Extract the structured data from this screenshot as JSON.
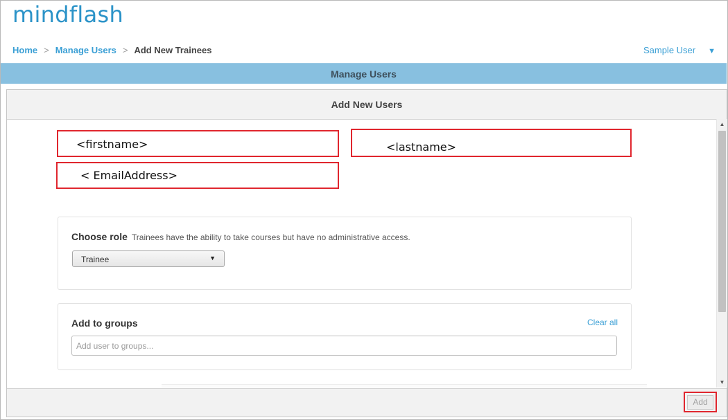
{
  "brand": {
    "logo_text": "mindflash"
  },
  "breadcrumb": {
    "home": "Home",
    "separator": ">",
    "manage_users": "Manage Users",
    "current": "Add New Trainees"
  },
  "user_menu": {
    "name": "Sample User",
    "caret": "▼"
  },
  "band": {
    "title": "Manage Users"
  },
  "dialog": {
    "title": "Add New Users",
    "fields": {
      "firstname": "<firstname>",
      "lastname": "<lastname>",
      "email": "< EmailAddress>"
    },
    "role": {
      "heading": "Choose role",
      "description": "Trainees have the ability to take courses but have no administrative access.",
      "selected": "Trainee"
    },
    "groups": {
      "heading": "Add to groups",
      "clear_all": "Clear all",
      "placeholder": "Add user to groups..."
    },
    "footer": {
      "add_label": "Add"
    }
  },
  "colors": {
    "accent": "#3a9fd5",
    "band": "#88c0e0",
    "highlight": "#e0262e"
  }
}
